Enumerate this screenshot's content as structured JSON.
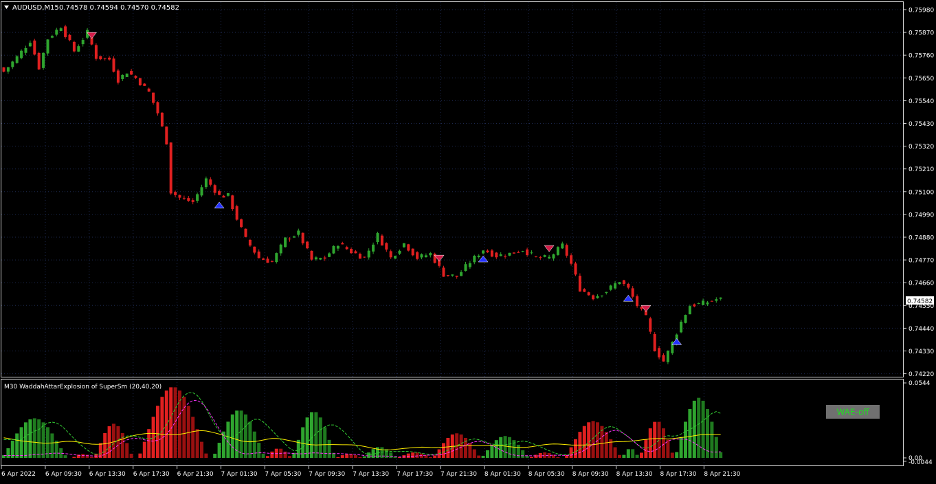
{
  "colors": {
    "background": "#000000",
    "frame": "#d8d8d8",
    "grid": "#1e2a50",
    "text": "#ffffff",
    "bull": "#2fa52f",
    "bear": "#e02020",
    "bear_dark": "#9a1010",
    "bull_dark": "#1f7a1f",
    "signal_up": "#2633ff",
    "signal_down": "#d41e4a",
    "explosion_line": "#ffee00",
    "deadzone_line": "#ff33ff",
    "trend_line": "#33cc33",
    "badge_bg": "#707070",
    "badge_text": "#22dd22"
  },
  "header": {
    "symbol_timeframe": "AUDUSD,M15",
    "ohlc": "0.74578 0.74594 0.74570 0.74582",
    "menu_icon": "triangle-down-icon"
  },
  "price_axis": {
    "labels": [
      "0.75980",
      "0.75870",
      "0.75760",
      "0.75650",
      "0.75540",
      "0.75430",
      "0.75320",
      "0.75210",
      "0.75100",
      "0.74990",
      "0.74880",
      "0.74770",
      "0.74660",
      "0.74550",
      "0.74440",
      "0.74330",
      "0.74220"
    ],
    "current_price": "0.74582"
  },
  "indicator": {
    "title": "M30 WaddahAttarExplosion of SuperSm (20,40,20)",
    "axis_labels": [
      "0.0544",
      "0.00",
      "-0.0044"
    ],
    "badge": "WAE-off"
  },
  "time_axis": {
    "labels": [
      "6 Apr 2022",
      "6 Apr 09:30",
      "6 Apr 13:30",
      "6 Apr 17:30",
      "6 Apr 21:30",
      "7 Apr 01:30",
      "7 Apr 05:30",
      "7 Apr 09:30",
      "7 Apr 13:30",
      "7 Apr 17:30",
      "7 Apr 21:30",
      "8 Apr 01:30",
      "8 Apr 05:30",
      "8 Apr 09:30",
      "8 Apr 13:30",
      "8 Apr 17:30",
      "8 Apr 21:30"
    ]
  },
  "chart_data": [
    {
      "type": "candlestick",
      "symbol": "AUDUSD",
      "timeframe": "M15",
      "ylim": [
        0.742,
        0.76
      ],
      "close_path": [
        [
          0,
          0.7568
        ],
        [
          3,
          0.7575
        ],
        [
          6,
          0.7583
        ],
        [
          8,
          0.757
        ],
        [
          10,
          0.7584
        ],
        [
          13,
          0.759
        ],
        [
          16,
          0.7578
        ],
        [
          19,
          0.7587
        ],
        [
          21,
          0.7575
        ],
        [
          24,
          0.7574
        ],
        [
          26,
          0.7564
        ],
        [
          28,
          0.7568
        ],
        [
          30,
          0.7565
        ],
        [
          33,
          0.7558
        ],
        [
          35,
          0.7548
        ],
        [
          37,
          0.7534
        ],
        [
          38,
          0.751
        ],
        [
          40,
          0.7507
        ],
        [
          43,
          0.7505
        ],
        [
          46,
          0.7516
        ],
        [
          49,
          0.7508
        ],
        [
          51,
          0.7508
        ],
        [
          53,
          0.7497
        ],
        [
          55,
          0.7487
        ],
        [
          58,
          0.7478
        ],
        [
          61,
          0.7476
        ],
        [
          64,
          0.7487
        ],
        [
          67,
          0.749
        ],
        [
          70,
          0.7477
        ],
        [
          73,
          0.7478
        ],
        [
          76,
          0.7485
        ],
        [
          79,
          0.7481
        ],
        [
          82,
          0.7478
        ],
        [
          85,
          0.7489
        ],
        [
          88,
          0.7478
        ],
        [
          91,
          0.7485
        ],
        [
          94,
          0.7478
        ],
        [
          97,
          0.748
        ],
        [
          100,
          0.747
        ],
        [
          103,
          0.7469
        ],
        [
          106,
          0.7476
        ],
        [
          109,
          0.7482
        ],
        [
          112,
          0.7479
        ],
        [
          115,
          0.748
        ],
        [
          118,
          0.7482
        ],
        [
          121,
          0.7478
        ],
        [
          124,
          0.7478
        ],
        [
          127,
          0.7484
        ],
        [
          129,
          0.7475
        ],
        [
          131,
          0.7463
        ],
        [
          134,
          0.7459
        ],
        [
          137,
          0.7462
        ],
        [
          140,
          0.7467
        ],
        [
          142,
          0.7463
        ],
        [
          144,
          0.7455
        ],
        [
          146,
          0.7449
        ],
        [
          148,
          0.7434
        ],
        [
          150,
          0.7428
        ],
        [
          152,
          0.7437
        ],
        [
          154,
          0.7447
        ],
        [
          156,
          0.7455
        ],
        [
          159,
          0.7456
        ],
        [
          162,
          0.7458
        ],
        [
          163,
          0.7458
        ]
      ],
      "signals": [
        {
          "bar": 20,
          "dir": "down"
        },
        {
          "bar": 49,
          "dir": "up"
        },
        {
          "bar": 99,
          "dir": "down"
        },
        {
          "bar": 109,
          "dir": "up"
        },
        {
          "bar": 124,
          "dir": "down"
        },
        {
          "bar": 142,
          "dir": "up"
        },
        {
          "bar": 146,
          "dir": "down"
        },
        {
          "bar": 153,
          "dir": "up"
        }
      ]
    },
    {
      "type": "bar",
      "title": "M30 WaddahAttarExplosion of SuperSm (20,40,20)",
      "ylim": [
        -0.0044,
        0.0544
      ],
      "humps": [
        {
          "start": 0,
          "end": 15,
          "peak": 0.029,
          "dir": "up"
        },
        {
          "start": 16,
          "end": 21,
          "peak": 0.003,
          "dir": "down"
        },
        {
          "start": 21,
          "end": 30,
          "peak": 0.025,
          "dir": "down"
        },
        {
          "start": 31,
          "end": 47,
          "peak": 0.052,
          "dir": "down"
        },
        {
          "start": 48,
          "end": 60,
          "peak": 0.035,
          "dir": "up"
        },
        {
          "start": 60,
          "end": 66,
          "peak": 0.007,
          "dir": "down"
        },
        {
          "start": 66,
          "end": 76,
          "peak": 0.034,
          "dir": "up"
        },
        {
          "start": 76,
          "end": 82,
          "peak": 0.003,
          "dir": "down"
        },
        {
          "start": 82,
          "end": 90,
          "peak": 0.008,
          "dir": "up"
        },
        {
          "start": 90,
          "end": 98,
          "peak": 0.004,
          "dir": "down"
        },
        {
          "start": 98,
          "end": 109,
          "peak": 0.018,
          "dir": "down"
        },
        {
          "start": 109,
          "end": 120,
          "peak": 0.016,
          "dir": "up"
        },
        {
          "start": 120,
          "end": 127,
          "peak": 0.004,
          "dir": "down"
        },
        {
          "start": 128,
          "end": 141,
          "peak": 0.027,
          "dir": "down"
        },
        {
          "start": 141,
          "end": 145,
          "peak": 0.007,
          "dir": "up"
        },
        {
          "start": 145,
          "end": 153,
          "peak": 0.027,
          "dir": "down"
        },
        {
          "start": 153,
          "end": 164,
          "peak": 0.044,
          "dir": "up"
        }
      ]
    }
  ]
}
